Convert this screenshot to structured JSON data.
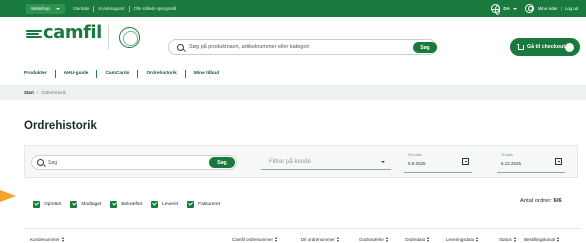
{
  "topbar": {
    "webshop_label": "Webshop",
    "links": [
      "Startside",
      "Kundesupport",
      "Ofte stillede spørgsmål"
    ],
    "language": "DA",
    "account_label": "Mine sider",
    "separator": "|",
    "logout_label": "Log ud"
  },
  "header": {
    "logo_text": "camfil",
    "search_placeholder": "Søg på produktnavn, artikelnummer eller kategori",
    "search_button": "Søg",
    "checkout_label": "Gå til checkout"
  },
  "nav": {
    "items": [
      "Produkter",
      "AHU-guide",
      "CamCards",
      "Ordrehistorik",
      "Mine tilbud"
    ]
  },
  "breadcrumb": {
    "home": "Start",
    "arrow": "›",
    "current": "Ordrehistorik"
  },
  "page": {
    "title": "Ordrehistorik"
  },
  "filters": {
    "search_placeholder": "Søg",
    "search_button": "Søg",
    "customer_placeholder": "Filtrer på kunde",
    "date_from_label": "Fra dato",
    "date_from_value": "9.9.2025",
    "date_to_label": "Til dato",
    "date_to_value": "6.12.2025"
  },
  "statuses": [
    {
      "label": "Oprettet",
      "checked": true
    },
    {
      "label": "Modtaget",
      "checked": true
    },
    {
      "label": "Bekræftet",
      "checked": true
    },
    {
      "label": "Leveret",
      "checked": true
    },
    {
      "label": "Faktureret",
      "checked": true
    }
  ],
  "order_count": {
    "label": "Antal ordrer:",
    "value": "6/6"
  },
  "table": {
    "columns": [
      "Kundenummer",
      "Camfil ordrenummer",
      "Dit ordrenummer",
      "Godsmærke",
      "Ordredato",
      "Leveringsdato",
      "Status",
      "Bestillingskanal"
    ]
  },
  "colors": {
    "brand_green": "#1a7a3e",
    "pointer_orange": "#f5a22a"
  },
  "icons": {
    "logo": "camfil-logo-arrow",
    "seal": "camfil-seal",
    "globe": "globe-icon",
    "user": "user-icon",
    "search": "search-icon",
    "cart": "cart-icon",
    "calendar": "calendar-icon",
    "checkbox": "checkbox-checked-icon",
    "sort": "sort-icon"
  }
}
